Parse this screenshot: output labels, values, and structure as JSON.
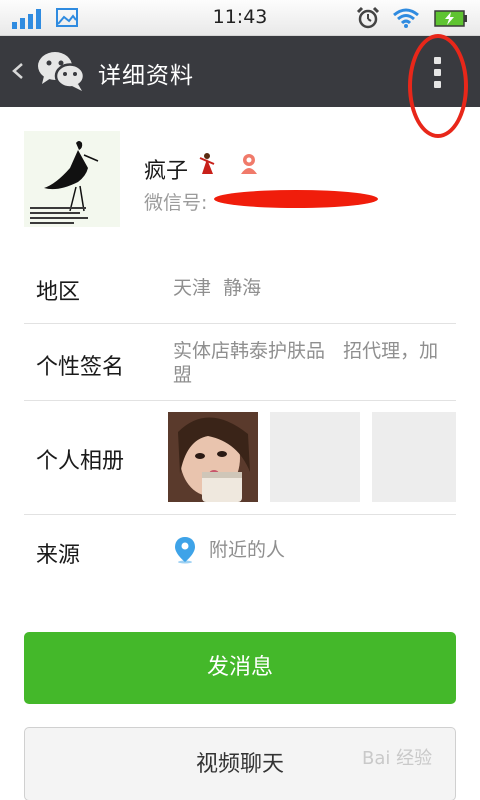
{
  "status_bar": {
    "time": "11:43",
    "icons": [
      "signal-icon",
      "image-notification-icon",
      "alarm-icon",
      "wifi-icon",
      "battery-charging-icon"
    ]
  },
  "header": {
    "back_icon": "chevron-left-icon",
    "logo_icon": "wechat-logo-icon",
    "title": "详细资料",
    "more_icon": "more-vertical-icon"
  },
  "profile": {
    "nickname": "疯子",
    "wechat_id_label": "微信号:"
  },
  "rows": {
    "region": {
      "label": "地区",
      "value": "天津  静海"
    },
    "signature": {
      "label": "个性签名",
      "value": "实体店韩泰护肤品   招代理，加盟"
    },
    "album": {
      "label": "个人相册"
    },
    "source": {
      "label": "来源",
      "value": "附近的人"
    }
  },
  "buttons": {
    "send_message": "发消息",
    "video_chat": "视频聊天"
  },
  "watermark": "Bai 经验",
  "colors": {
    "titlebar": "#393a3f",
    "primary_green": "#44b82a",
    "annotation_red": "#e8271a",
    "location_blue": "#3ea3e8"
  }
}
